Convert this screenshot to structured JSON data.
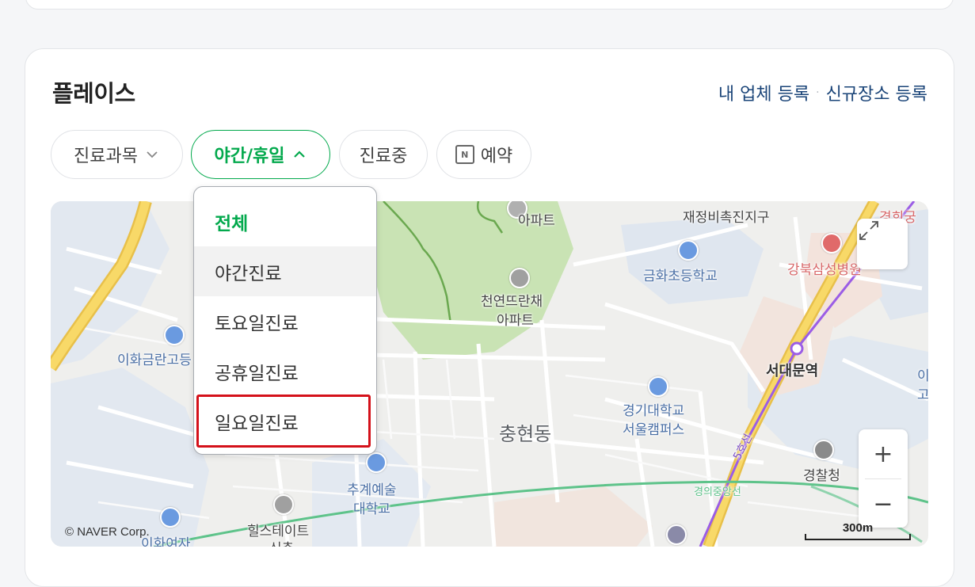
{
  "section": {
    "title": "플레이스",
    "link_register_business": "내 업체 등록",
    "link_separator": "·",
    "link_new_place": "신규장소 등록"
  },
  "filters": {
    "department": "진료과목",
    "night_holiday": "야간/휴일",
    "in_treatment": "진료중",
    "reservation_icon_letter": "N",
    "reservation": "예약"
  },
  "dropdown": {
    "items": [
      "전체",
      "야간진료",
      "토요일진료",
      "공휴일진료",
      "일요일진료"
    ],
    "selected_index": 0,
    "highlighted_index": 1,
    "boxed_index": 4
  },
  "map": {
    "labels": {
      "apt_top": "아파트",
      "redevelopment": "재정비촉진지구",
      "gyeonghui": "경희궁",
      "geumhwa": "금화초등학교",
      "kangbuk_samsung": "강북삼성병원",
      "cheonyeon_apt": "천연뜨란채",
      "cheonyeon_apt2": "아파트",
      "ewha_geumran": "이화금란고등",
      "seodaemun": "서대문역",
      "kyonggi_univ": "경기대학교",
      "kyonggi_univ2": "서울캠퍼스",
      "chunghyeon": "충현동",
      "line5": "5호선",
      "police": "경찰청",
      "chugye": "추계예술",
      "chugye2": "대학교",
      "gyeongui": "경의중앙선",
      "hillstate": "힐스테이트",
      "hillstate2": "신촌",
      "ewha_girls": "이화여자",
      "right_edge1": "이",
      "right_edge2": "고"
    },
    "copyright": "© NAVER Corp.",
    "zoom_in": "+",
    "zoom_out": "−",
    "scale": "300m",
    "colors": {
      "park": "#c9e3b4",
      "road_major": "#f6c94e",
      "subway_line5": "#9b5de5",
      "rail": "#5ec38a"
    }
  }
}
